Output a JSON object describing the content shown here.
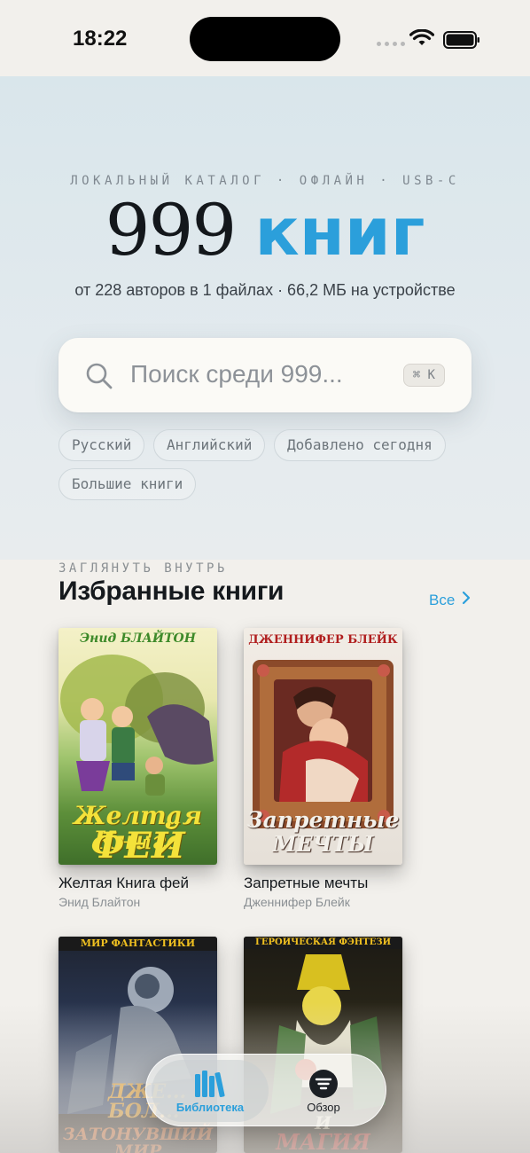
{
  "status_bar": {
    "time": "18:22"
  },
  "hero": {
    "eyebrow": "ЛОКАЛЬНЫЙ КАТАЛОГ · ОФЛАЙН · USB-C",
    "count": "999",
    "count_unit": "книг",
    "subtitle": "от 228 авторов в 1 файлах · 66,2 МБ на устройстве",
    "accent_color": "#2b9fdb"
  },
  "search": {
    "placeholder": "Поиск среди 999...",
    "shortcut": "⌘ K",
    "icon": "search-icon"
  },
  "chips": [
    "Русский",
    "Английский",
    "Добавлено сегодня",
    "Большие книги"
  ],
  "featured": {
    "eyebrow": "ЗАГЛЯНУТЬ ВНУТРЬ",
    "title": "Избранные книги",
    "see_all": "Все",
    "books": [
      {
        "title": "Желтая Книга фей",
        "author": "Энид Блайтон",
        "cover_top": "Энид БЛАЙТОН",
        "cover_line1": "Желтая Книга",
        "cover_line2": "ФЕЙ"
      },
      {
        "title": "Запретные мечты",
        "author": "Дженнифер Блейк",
        "cover_top": "ДЖЕННИФЕР БЛЕЙК",
        "cover_line1": "Запретные",
        "cover_line2": "МЕЧТЫ"
      },
      {
        "cover_top": "МИР ФАНТАСТИКИ",
        "cover_line1": "ДЖЕ...",
        "cover_line2": "БОЛ...",
        "cover_line3": "ЗАТОНУВШИЙ МИР"
      },
      {
        "cover_top": "ГЕРОИЧЕСКАЯ ФЭНТЕЗИ",
        "cover_line1": "И",
        "cover_line2": "МАГИЯ"
      }
    ]
  },
  "tab_bar": {
    "tabs": [
      {
        "label": "Библиотека",
        "icon": "library-books-icon",
        "active": true
      },
      {
        "label": "Обзор",
        "icon": "browse-filter-icon",
        "active": false
      }
    ]
  }
}
